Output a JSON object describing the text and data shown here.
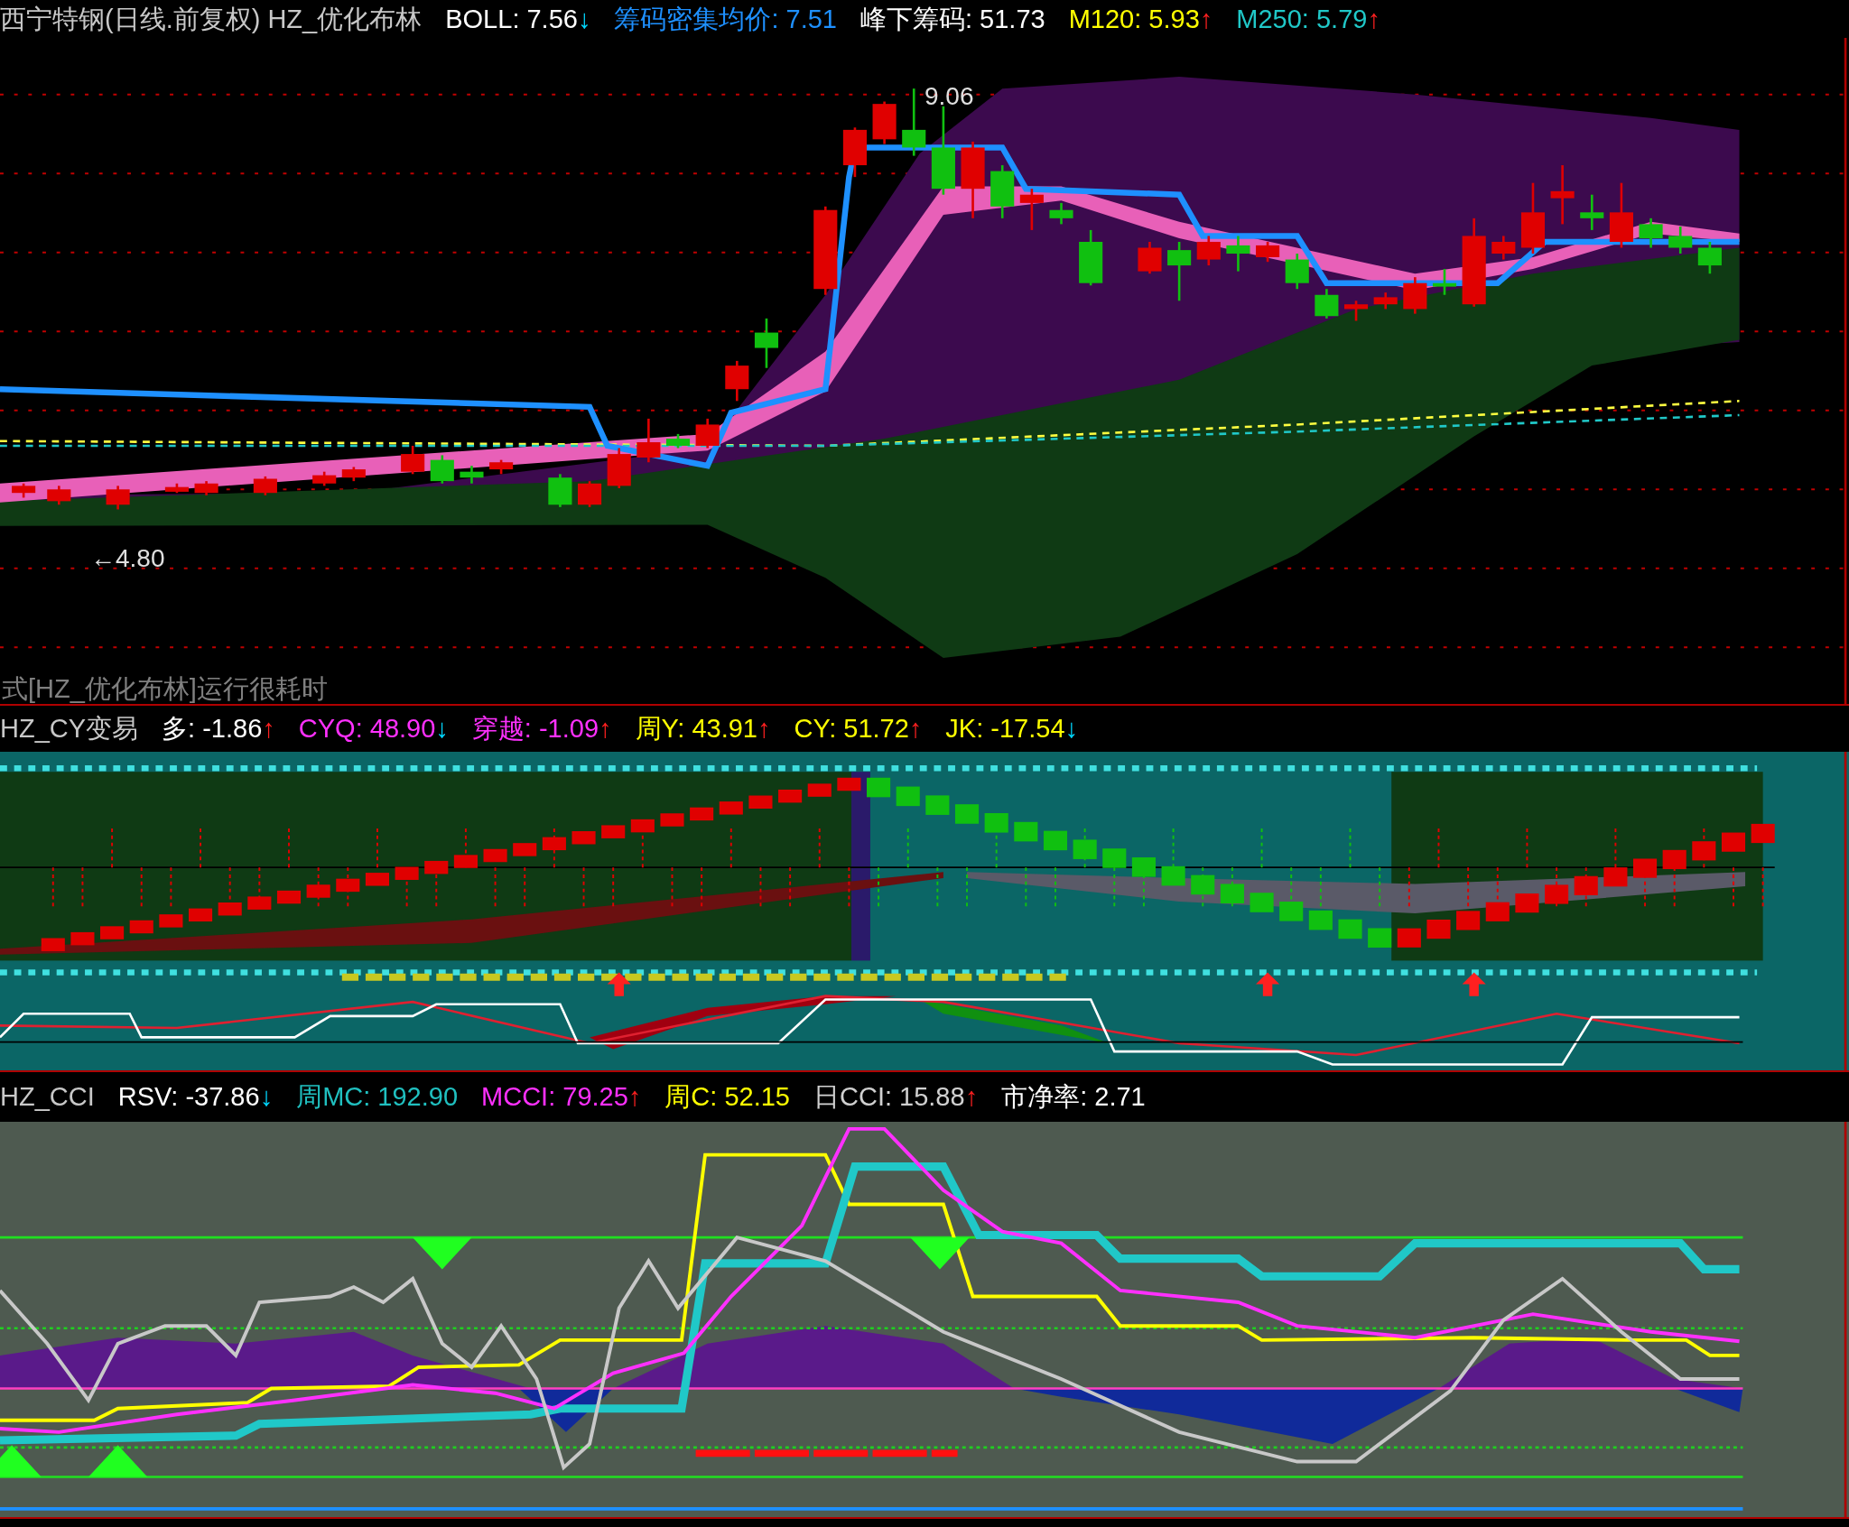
{
  "main_panel": {
    "header": [
      {
        "text": "西宁特钢(日线.前复权) HZ_优化布林",
        "color": "#c8c8c8"
      },
      {
        "text": "BOLL: 7.56",
        "color": "#ffffff",
        "arrow": {
          "text": "↓",
          "color": "#00d8ff"
        }
      },
      {
        "text": "筹码密集均价: 7.51",
        "color": "#1e90ff"
      },
      {
        "text": "峰下筹码: 51.73",
        "color": "#ffffff"
      },
      {
        "text": "M120: 5.93",
        "color": "#ffff00",
        "arrow": {
          "text": "↑",
          "color": "#ff2020"
        }
      },
      {
        "text": "M250: 5.79",
        "color": "#20c8c8",
        "arrow": {
          "text": "↑",
          "color": "#ff2020"
        }
      }
    ],
    "chart_labels": [
      {
        "text": "9.06"
      },
      {
        "text": "←4.80"
      }
    ],
    "notice": "式[HZ_优化布林]运行很耗时"
  },
  "cy_panel": {
    "header": [
      {
        "text": "HZ_CY变易",
        "color": "#c8c8c8"
      },
      {
        "text": "多: -1.86",
        "color": "#ffffff",
        "arrow": {
          "text": "↑",
          "color": "#ff2020"
        }
      },
      {
        "text": "CYQ: 48.90",
        "color": "#ff30ff",
        "arrow": {
          "text": "↓",
          "color": "#00d8ff"
        }
      },
      {
        "text": "穿越: -1.09",
        "color": "#ff30ff",
        "arrow": {
          "text": "↑",
          "color": "#ff2020"
        }
      },
      {
        "text": "周Y: 43.91",
        "color": "#ffff00",
        "arrow": {
          "text": "↑",
          "color": "#ff2020"
        }
      },
      {
        "text": "CY: 51.72",
        "color": "#ffff00",
        "arrow": {
          "text": "↑",
          "color": "#ff2020"
        }
      },
      {
        "text": "JK: -17.54",
        "color": "#ffff00",
        "arrow": {
          "text": "↓",
          "color": "#00d8ff"
        }
      }
    ]
  },
  "cci_panel": {
    "header": [
      {
        "text": "HZ_CCI",
        "color": "#c8c8c8"
      },
      {
        "text": "RSV: -37.86",
        "color": "#ffffff",
        "arrow": {
          "text": "↓",
          "color": "#00d8ff"
        }
      },
      {
        "text": "周MC: 192.90",
        "color": "#20c0c0"
      },
      {
        "text": "MCCI: 79.25",
        "color": "#ff30ff",
        "arrow": {
          "text": "↑",
          "color": "#ff2020"
        }
      },
      {
        "text": "周C: 52.15",
        "color": "#ffff00"
      },
      {
        "text": "日CCI: 15.88",
        "color": "#d0d0d0",
        "arrow": {
          "text": "↑",
          "color": "#ff2020"
        }
      },
      {
        "text": "市净率: 2.71",
        "color": "#ffffff"
      }
    ]
  }
}
